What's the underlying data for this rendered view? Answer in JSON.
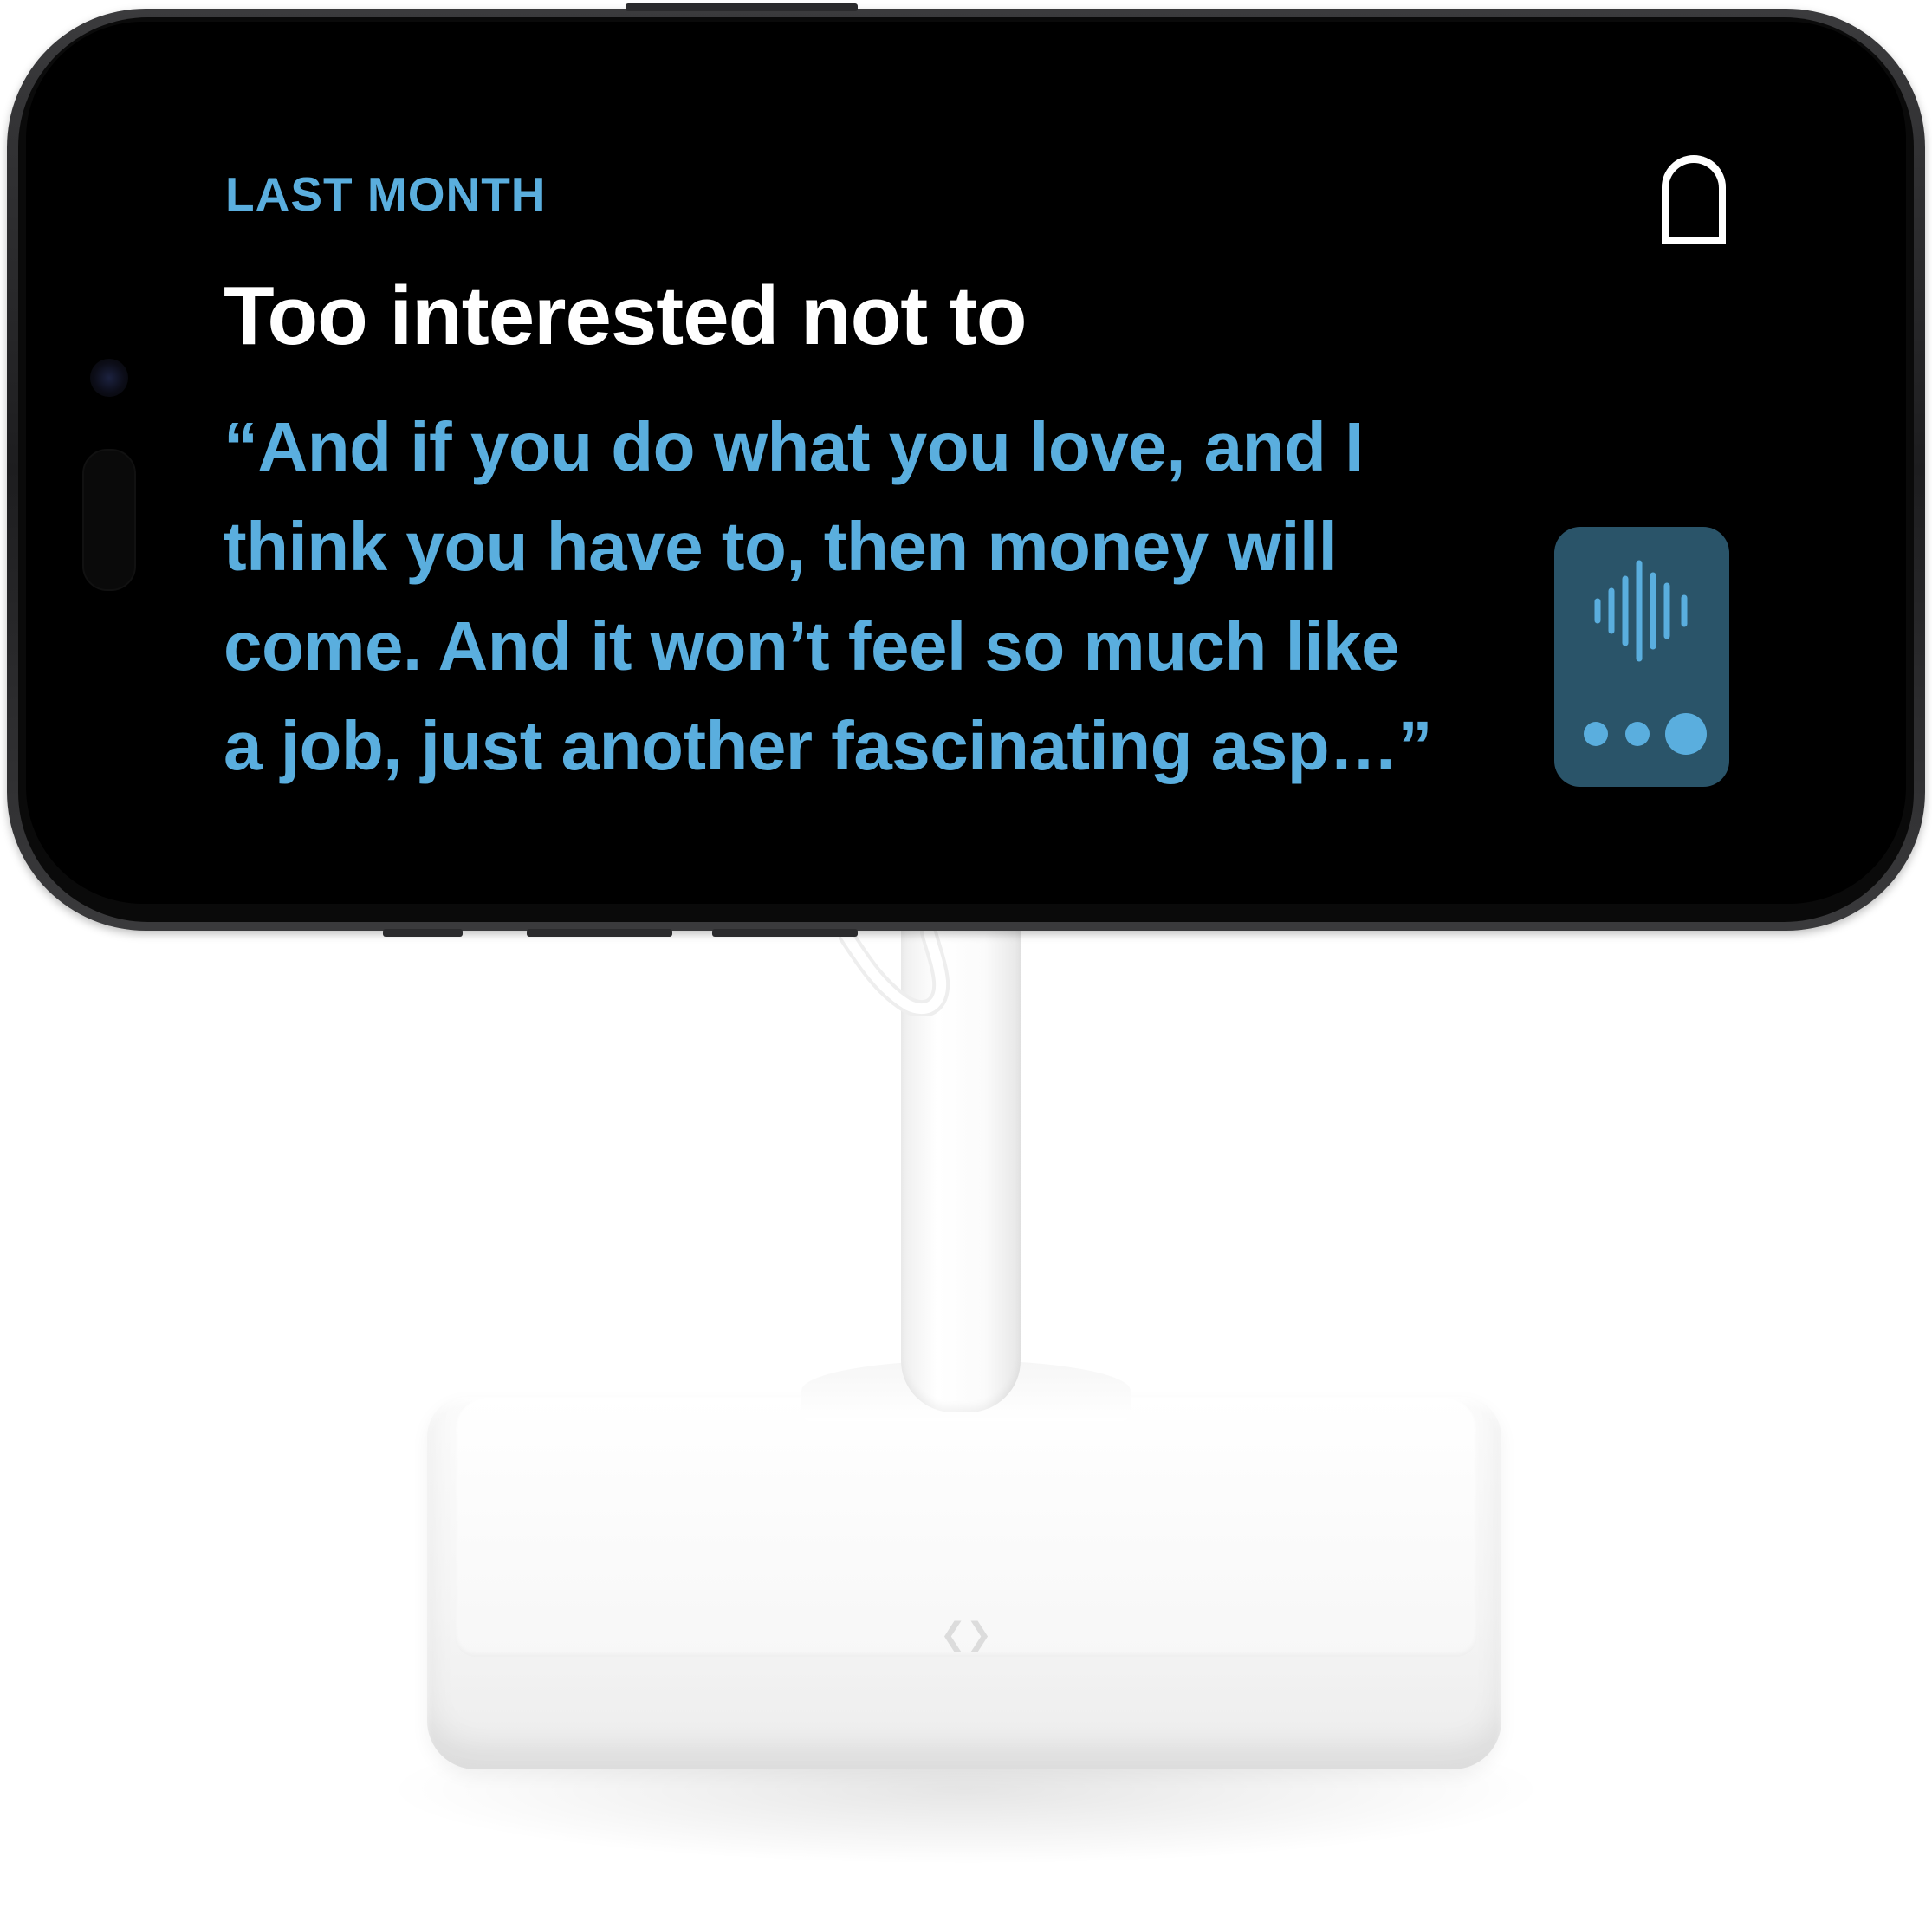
{
  "screen": {
    "eyebrow": "LAST MONTH",
    "headline": "Too interested not to",
    "quote_lines": [
      "“And if you do what you love, and I",
      "think you have to, then money will",
      "come. And it won’t feel so much like",
      "a job, just another fascinating asp…”"
    ]
  },
  "widget": {
    "icon": "waveform-icon",
    "page_count": 3,
    "active_page": 3
  },
  "colors": {
    "accent": "#5aaede",
    "headline": "#ffffff",
    "widget_bg": "#2a5469",
    "screen_bg": "#000000"
  }
}
